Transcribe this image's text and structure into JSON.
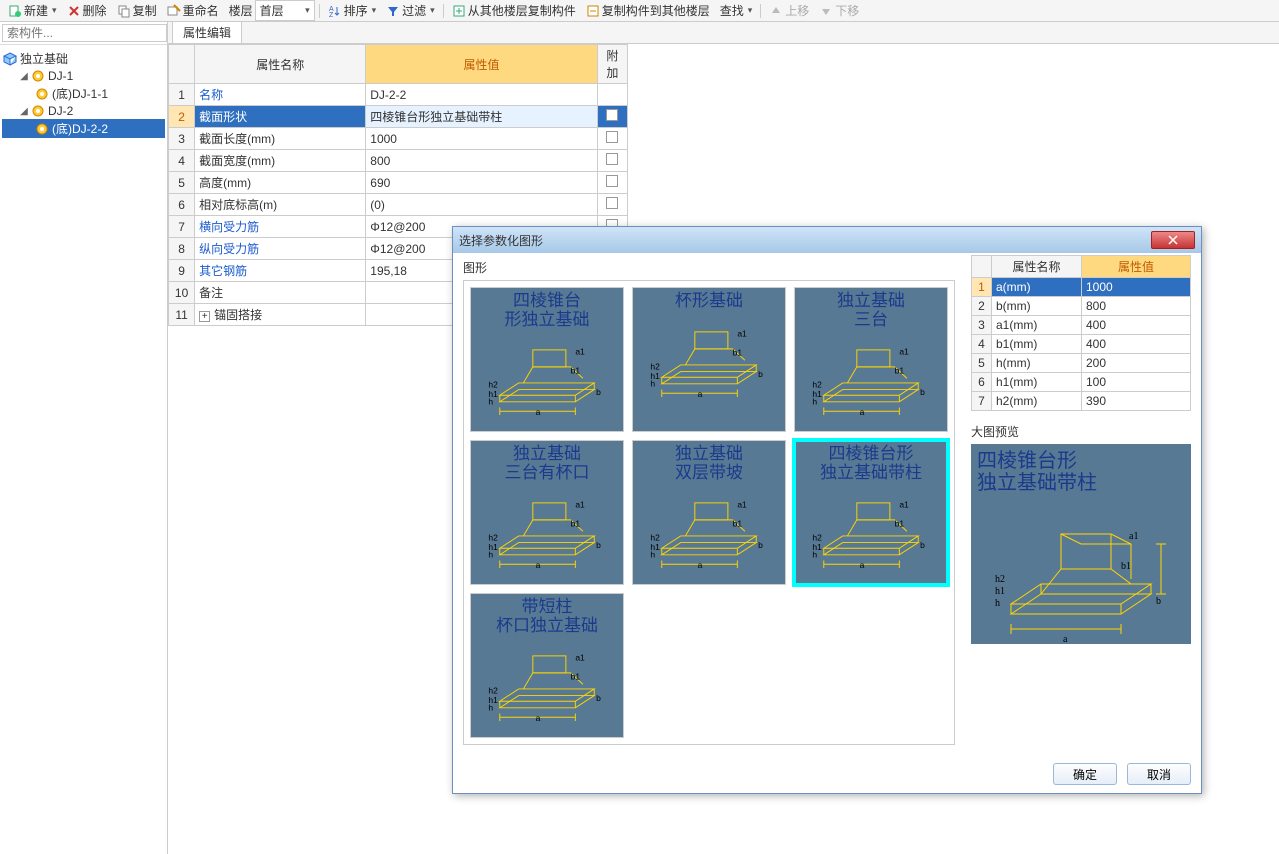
{
  "toolbar": {
    "new": "新建",
    "delete": "删除",
    "copy": "复制",
    "rename": "重命名",
    "floor_label": "楼层",
    "floor_sel": "首层",
    "sort": "排序",
    "filter": "过滤",
    "copy_from": "从其他楼层复制构件",
    "copy_to": "复制构件到其他楼层",
    "find": "查找",
    "up": "上移",
    "down": "下移"
  },
  "sidebar": {
    "search_ph": "索构件...",
    "root": "独立基础",
    "nodes": {
      "dj1": "DJ-1",
      "dj1b": "(底)DJ-1-1",
      "dj2": "DJ-2",
      "dj2b": "(底)DJ-2-2"
    }
  },
  "tab": "属性编辑",
  "prop_headers": {
    "name": "属性名称",
    "value": "属性值",
    "add": "附加"
  },
  "props": [
    {
      "n": "1",
      "name": "名称",
      "value": "DJ-2-2",
      "link": true,
      "chk": false
    },
    {
      "n": "2",
      "name": "截面形状",
      "value": "四棱锥台形独立基础带柱",
      "link": true,
      "sel": true,
      "chk": true
    },
    {
      "n": "3",
      "name": "截面长度(mm)",
      "value": "1000",
      "chk": true
    },
    {
      "n": "4",
      "name": "截面宽度(mm)",
      "value": "800",
      "chk": true
    },
    {
      "n": "5",
      "name": "高度(mm)",
      "value": "690",
      "chk": true
    },
    {
      "n": "6",
      "name": "相对底标高(m)",
      "value": "(0)",
      "chk": true
    },
    {
      "n": "7",
      "name": "横向受力筋",
      "value": "Φ12@200",
      "link": true,
      "chk": true
    },
    {
      "n": "8",
      "name": "纵向受力筋",
      "value": "Φ12@200",
      "link": true,
      "chk": true
    },
    {
      "n": "9",
      "name": "其它钢筋",
      "value": "195,18",
      "link": true,
      "chk": false
    },
    {
      "n": "10",
      "name": "备注",
      "value": "",
      "chk": true
    },
    {
      "n": "11",
      "name": "锚固搭接",
      "value": "",
      "exp": true,
      "chk": false
    }
  ],
  "dialog": {
    "title": "选择参数化图形",
    "shapes_label": "图形",
    "shapes": [
      "四棱锥台\n形独立基础",
      "杯形基础",
      "独立基础\n三台",
      "独立基础\n三台有杯口",
      "独立基础\n双层带坡",
      "四棱锥台形\n独立基础带柱",
      "带短柱\n杯口独立基础"
    ],
    "prop_headers": {
      "name": "属性名称",
      "value": "属性值"
    },
    "props": [
      {
        "n": "1",
        "name": "a(mm)",
        "value": "1000",
        "sel": true
      },
      {
        "n": "2",
        "name": "b(mm)",
        "value": "800"
      },
      {
        "n": "3",
        "name": "a1(mm)",
        "value": "400"
      },
      {
        "n": "4",
        "name": "b1(mm)",
        "value": "400"
      },
      {
        "n": "5",
        "name": "h(mm)",
        "value": "200"
      },
      {
        "n": "6",
        "name": "h1(mm)",
        "value": "100"
      },
      {
        "n": "7",
        "name": "h2(mm)",
        "value": "390"
      }
    ],
    "preview_label": "大图预览",
    "preview_title": "四棱锥台形\n独立基础带柱",
    "ok": "确定",
    "cancel": "取消"
  }
}
